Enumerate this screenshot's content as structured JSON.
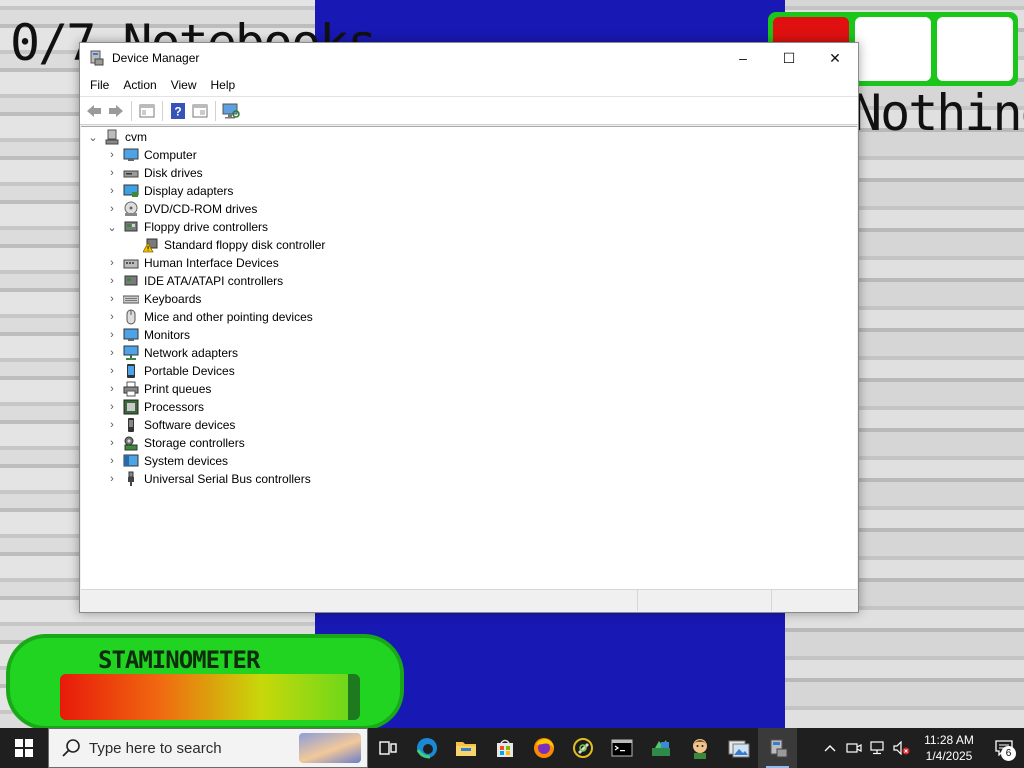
{
  "game": {
    "notebooks_text": "0/7 Notebooks",
    "item_name": "Nothing",
    "stamina_label": "STAMINOMETER",
    "stamina_level": 0.96,
    "colors": {
      "blue": "#1818b4",
      "slot_selected": "#e01010",
      "green": "#22d422"
    }
  },
  "window": {
    "title": "Device Manager",
    "icon": "device-manager-icon",
    "controls": {
      "minimize": "–",
      "maximize": "☐",
      "close": "✕"
    }
  },
  "menu": [
    "File",
    "Action",
    "View",
    "Help"
  ],
  "toolbar": [
    "back-icon",
    "forward-icon",
    "properties-icon",
    "help-icon",
    "show-hide-icon",
    "scan-hardware-icon"
  ],
  "tree": {
    "root": "cvm",
    "categories": [
      {
        "label": "Computer",
        "icon": "computer-icon",
        "expanded": false
      },
      {
        "label": "Disk drives",
        "icon": "disk-drive-icon",
        "expanded": false
      },
      {
        "label": "Display adapters",
        "icon": "display-adapter-icon",
        "expanded": false
      },
      {
        "label": "DVD/CD-ROM drives",
        "icon": "dvd-drive-icon",
        "expanded": false
      },
      {
        "label": "Floppy drive controllers",
        "icon": "floppy-controller-icon",
        "expanded": true,
        "children": [
          {
            "label": "Standard floppy disk controller",
            "icon": "warning-device-icon"
          }
        ]
      },
      {
        "label": "Human Interface Devices",
        "icon": "hid-icon",
        "expanded": false
      },
      {
        "label": "IDE ATA/ATAPI controllers",
        "icon": "ide-controller-icon",
        "expanded": false
      },
      {
        "label": "Keyboards",
        "icon": "keyboard-icon",
        "expanded": false
      },
      {
        "label": "Mice and other pointing devices",
        "icon": "mouse-icon",
        "expanded": false
      },
      {
        "label": "Monitors",
        "icon": "monitor-icon",
        "expanded": false
      },
      {
        "label": "Network adapters",
        "icon": "network-adapter-icon",
        "expanded": false
      },
      {
        "label": "Portable Devices",
        "icon": "portable-device-icon",
        "expanded": false
      },
      {
        "label": "Print queues",
        "icon": "printer-icon",
        "expanded": false
      },
      {
        "label": "Processors",
        "icon": "processor-icon",
        "expanded": false
      },
      {
        "label": "Software devices",
        "icon": "software-device-icon",
        "expanded": false
      },
      {
        "label": "Storage controllers",
        "icon": "storage-controller-icon",
        "expanded": false
      },
      {
        "label": "System devices",
        "icon": "system-device-icon",
        "expanded": false
      },
      {
        "label": "Universal Serial Bus controllers",
        "icon": "usb-icon",
        "expanded": false
      }
    ]
  },
  "taskbar": {
    "search_placeholder": "Type here to search",
    "apps": [
      "task-view-icon",
      "edge-icon",
      "file-explorer-icon",
      "store-icon",
      "firefox-icon",
      "tool-icon",
      "terminal-icon",
      "app-icon",
      "avatar-app-icon",
      "photos-icon",
      "device-manager-icon"
    ],
    "time": "11:28 AM",
    "date": "1/4/2025",
    "notification_count": "6"
  }
}
